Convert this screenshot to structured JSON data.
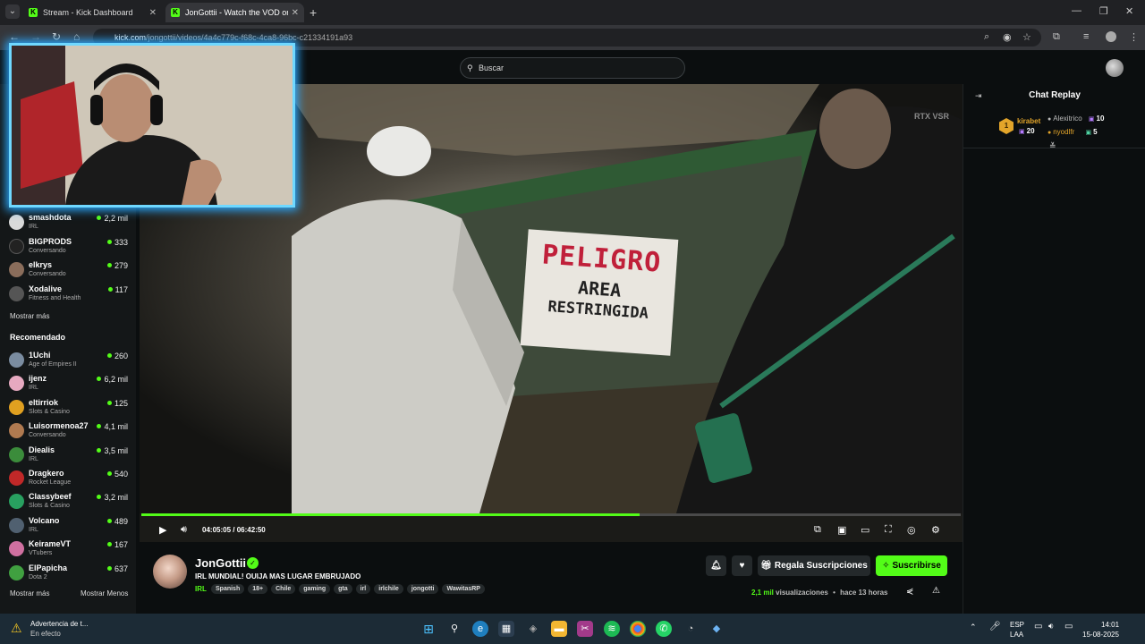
{
  "browser": {
    "tabs": [
      {
        "title": "Stream - Kick Dashboard",
        "favicon": "K"
      },
      {
        "title": "JonGottii - Watch the VOD on K",
        "favicon": "K"
      }
    ],
    "url_host": "kick.com",
    "url_path": "/jongottii/videos/4a4c779c-f68c-4ca8-96bc-c21334191a93"
  },
  "header": {
    "search_placeholder": "Buscar"
  },
  "sidebar": {
    "followed": [
      {
        "name": "smashdota",
        "category": "IRL",
        "viewers": "2,2 mil",
        "color": "#d9d9d9"
      },
      {
        "name": "BIGPRODS",
        "category": "Conversando",
        "viewers": "333",
        "color": "#222222"
      },
      {
        "name": "elkrys",
        "category": "Conversando",
        "viewers": "279",
        "color": "#8a6d5b"
      },
      {
        "name": "Xodalive",
        "category": "Fitness and Health",
        "viewers": "117",
        "color": "#555555"
      }
    ],
    "show_more": "Mostrar más",
    "recommended_heading": "Recomendado",
    "recommended": [
      {
        "name": "1Uchi",
        "category": "Age of Empires II",
        "viewers": "260",
        "color": "#7a8ca0"
      },
      {
        "name": "ijenz",
        "category": "IRL",
        "viewers": "6,2 mil",
        "color": "#e6a9c0"
      },
      {
        "name": "eltirriok",
        "category": "Slots & Casino",
        "viewers": "125",
        "color": "#e0a020"
      },
      {
        "name": "Luisormenoa27",
        "category": "Conversando",
        "viewers": "4,1 mil",
        "color": "#b07a50"
      },
      {
        "name": "Diealis",
        "category": "IRL",
        "viewers": "3,5 mil",
        "color": "#3b8c3b"
      },
      {
        "name": "Dragkero",
        "category": "Rocket League",
        "viewers": "540",
        "color": "#c02828"
      },
      {
        "name": "Classybeef",
        "category": "Slots & Casino",
        "viewers": "3,2 mil",
        "color": "#28a060"
      },
      {
        "name": "Volcano",
        "category": "IRL",
        "viewers": "489",
        "color": "#506070"
      },
      {
        "name": "KeirameVT",
        "category": "VTubers",
        "viewers": "167",
        "color": "#d070a0"
      },
      {
        "name": "ElPapicha",
        "category": "Dota 2",
        "viewers": "637",
        "color": "#40a040"
      }
    ],
    "show_more_bottom": "Mostrar más",
    "show_less": "Mostrar Menos"
  },
  "video": {
    "overlay_text": "RTX VSR",
    "sign_lines": [
      "PELIGRO",
      "AREA",
      "RESTRINGIDA"
    ],
    "current_time": "04:05:05",
    "separator": "/",
    "duration": "06:42:50",
    "progress_fraction": 0.608
  },
  "chat": {
    "title": "Chat Replay",
    "top_rank": "1",
    "gifters": [
      {
        "name": "kirabet",
        "count": "20",
        "color": "#e3a52a"
      },
      {
        "name": "Alexitrico",
        "count": "10",
        "color": "#bbbbbb"
      },
      {
        "name": "nyodlfr",
        "count": "5",
        "color": "#e3a52a"
      }
    ]
  },
  "stream": {
    "streamer": "JonGottii",
    "title": "IRL MUNDIAL! OUIJA MAS LUGAR EMBRUJADO",
    "category": "IRL",
    "tags": [
      "Spanish",
      "18+",
      "Chile",
      "gaming",
      "gta",
      "irl",
      "irlchile",
      "jongotti",
      "WawitasRP"
    ],
    "gift_button": "Regala Suscripciones",
    "subscribe_button": "Suscribirse",
    "views_num": "2,1 mil",
    "views_label": "visualizaciones",
    "time_ago": "hace 13 horas"
  },
  "taskbar": {
    "notification_title": "Advertencia de t...",
    "notification_sub": "En efecto",
    "lang1": "ESP",
    "lang2": "LAA",
    "time": "14:01",
    "date": "15-08-2025"
  },
  "colors": {
    "kick_green": "#53fc18",
    "background": "#0b0e0f",
    "sidebar": "#141718"
  }
}
